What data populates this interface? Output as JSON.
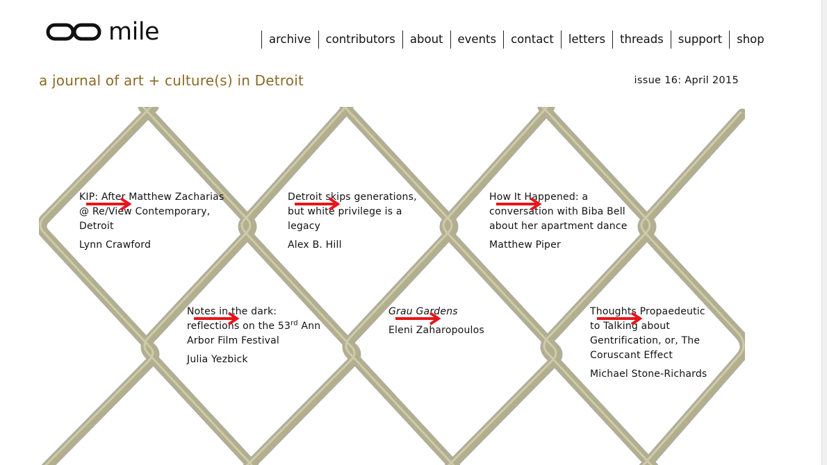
{
  "site": {
    "logo_text": "mile",
    "tagline": "a journal of art + culture(s) in Detroit",
    "issue": "issue 16: April 2015"
  },
  "nav": {
    "items": [
      {
        "label": "archive"
      },
      {
        "label": "contributors"
      },
      {
        "label": "about"
      },
      {
        "label": "events"
      },
      {
        "label": "contact"
      },
      {
        "label": "letters"
      },
      {
        "label": "threads"
      },
      {
        "label": "support"
      },
      {
        "label": "shop"
      }
    ]
  },
  "articles": [
    {
      "title": "KIP: After Matthew Zacharias @ Re/View Contemporary, Detroit",
      "author": "Lynn Crawford"
    },
    {
      "title": "Detroit skips generations, but white privilege is a legacy",
      "author": "Alex B. Hill"
    },
    {
      "title": "How It Happened: a conversation with Biba Bell about her apartment dance",
      "author": "Matthew Piper"
    },
    {
      "title_pre": "Notes in the dark: reflections on the 53",
      "title_sup": "rd",
      "title_post": " Ann Arbor Film Festival",
      "author": "Julia Yezbick"
    },
    {
      "title": "Grau Gardens",
      "author": "Eleni Zaharopoulos"
    },
    {
      "title": "Thoughts Propaedeutic to Talking about Gentrification, or, The Coruscant Effect",
      "author": "Michael Stone-Richards"
    }
  ],
  "colors": {
    "accent": "#8a6a26",
    "arrow": "#e8141a",
    "fence_wire": "#b3af8c"
  },
  "icons": {
    "logo": "infinity-loop-icon",
    "read_more": "right-arrow-icon"
  }
}
